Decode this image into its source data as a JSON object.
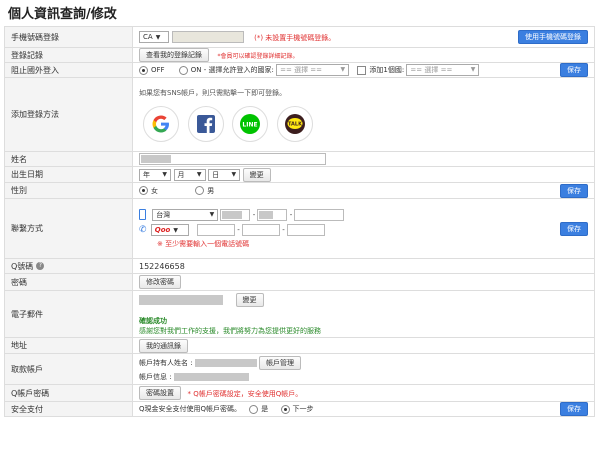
{
  "page_title": "個人資訊查詢/修改",
  "labels": {
    "mobile_login": "手機號碼登錄",
    "login_record": "登錄記錄",
    "block_foreign": "阻止國外登入",
    "add_login": "添加登錄方法",
    "name": "姓名",
    "birthday": "出生日期",
    "gender": "性別",
    "contact": "聯繫方式",
    "q_number": "Q號碼",
    "password": "密碼",
    "email": "電子郵件",
    "address": "地址",
    "bank_account": "取款帳戶",
    "qaccount_password": "Q帳戶密碼",
    "secure_payment": "安全支付"
  },
  "mobile_login": {
    "country": "CA",
    "warning": "(*) 未設置手機號碼登錄。",
    "use_button": "使用手機號碼登錄"
  },
  "login_record": {
    "view_button": "查看我的登錄記錄",
    "note": "*會員可以確認登錄詳細記錄。"
  },
  "block_foreign": {
    "off_label": "OFF",
    "on_label": "ON - 選擇允許登入的國家:",
    "select1": "== 選擇 ==",
    "add_country": "添加1個國:",
    "select2": "== 選擇 ==",
    "save": "保存"
  },
  "add_login": {
    "hint": "如果您有SNS帳戶，則只需點擊一下即可登錄。",
    "sns": [
      "google-icon",
      "facebook-icon",
      "line-icon",
      "kakaotalk-icon"
    ],
    "line_text": "LINE",
    "talk_text": "TALK"
  },
  "birthday": {
    "year": "年",
    "month": "月",
    "day": "日",
    "change": "變更"
  },
  "gender": {
    "female": "女",
    "male": "男",
    "save": "保存"
  },
  "contact": {
    "country": "台灣",
    "dash": "-",
    "qoo": "Qoo",
    "note": "※ 至少需要輸入一個電話號碼",
    "save": "保存"
  },
  "q_number": "152246658",
  "password": {
    "change": "修改密碼"
  },
  "email": {
    "change": "變更",
    "confirmed": "確認成功",
    "thanks": "感謝您對我們工作的支援，我們將努力為您提供更好的服務"
  },
  "address": {
    "my_address": "我的通訊錄"
  },
  "bank_account": {
    "holder_label": "帳戶持有人姓名 :",
    "manage": "帳戶管理",
    "info_label": "帳戶信息 :"
  },
  "qaccount_password": {
    "set": "密碼設置",
    "note": "* Q帳戶密碼設定，安全使用Q帳戶。"
  },
  "secure_payment": {
    "text": "Q現金安全支付使用Q帳戶密碼。",
    "yes": "是",
    "next": "下一步",
    "save": "保存"
  }
}
